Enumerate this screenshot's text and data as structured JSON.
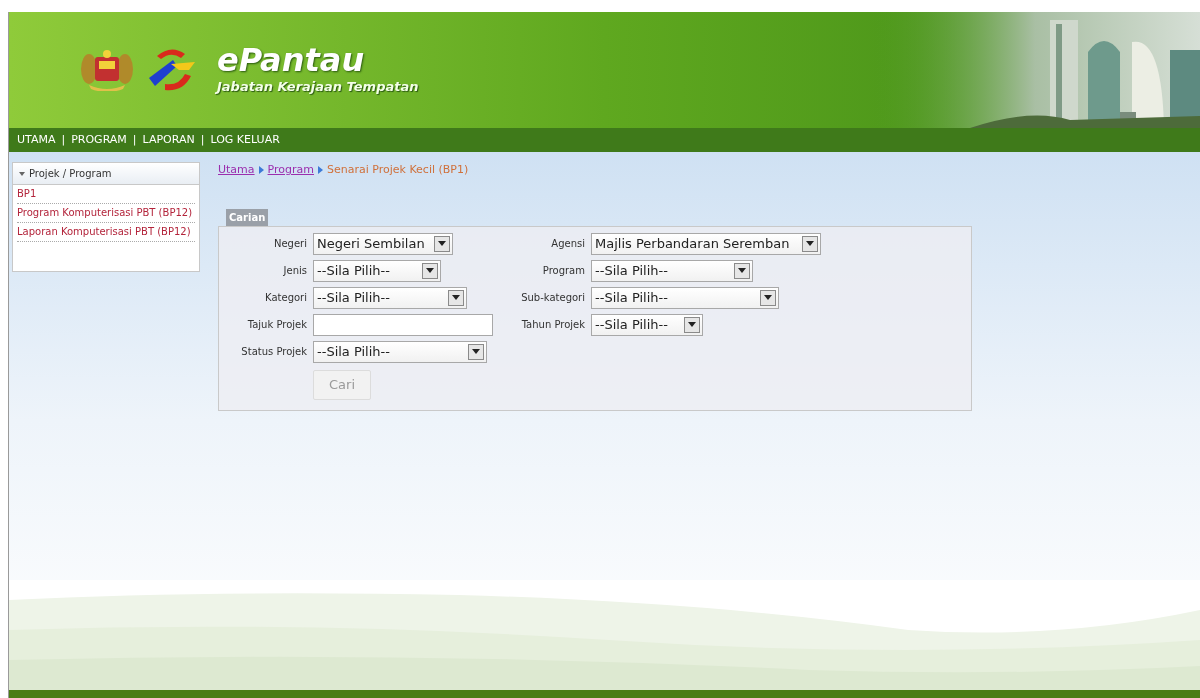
{
  "header": {
    "title": "ePantau",
    "subtitle": "Jabatan Kerajaan Tempatan"
  },
  "nav": [
    {
      "label": "UTAMA"
    },
    {
      "label": "PROGRAM"
    },
    {
      "label": "LAPORAN"
    },
    {
      "label": "LOG KELUAR"
    }
  ],
  "nav_separator": "|",
  "sidebar": {
    "title": "Projek / Program",
    "expanded": true,
    "items": [
      {
        "label": "BP1"
      },
      {
        "label": "Program Komputerisasi PBT (BP12)"
      },
      {
        "label": "Laporan Komputerisasi PBT (BP12)"
      }
    ]
  },
  "breadcrumb": [
    {
      "label": "Utama",
      "kind": "link"
    },
    {
      "label": "Program",
      "kind": "link"
    },
    {
      "label": "Senarai Projek Kecil (BP1)",
      "kind": "current"
    }
  ],
  "search": {
    "legend": "Carian",
    "rows": [
      [
        {
          "label": "Negeri",
          "kind": "select",
          "value": "Negeri Sembilan"
        },
        {
          "label": "Agensi",
          "kind": "select",
          "value": "Majlis Perbandaran Seremban"
        }
      ],
      [
        {
          "label": "Jenis",
          "kind": "select",
          "value": "--Sila Pilih--"
        },
        {
          "label": "Program",
          "kind": "select",
          "value": "--Sila Pilih--"
        }
      ],
      [
        {
          "label": "Kategori",
          "kind": "select",
          "value": "--Sila Pilih--"
        },
        {
          "label": "Sub-kategori",
          "kind": "select",
          "value": "--Sila Pilih--"
        }
      ],
      [
        {
          "label": "Tajuk Projek",
          "kind": "text"
        },
        {
          "label": "Tahun Projek",
          "kind": "select",
          "value": "--Sila Pilih--"
        }
      ],
      [
        {
          "label": "Status Projek",
          "kind": "select",
          "value": "--Sila Pilih--"
        }
      ]
    ],
    "button": {
      "label": "Cari",
      "disabled": true
    }
  }
}
